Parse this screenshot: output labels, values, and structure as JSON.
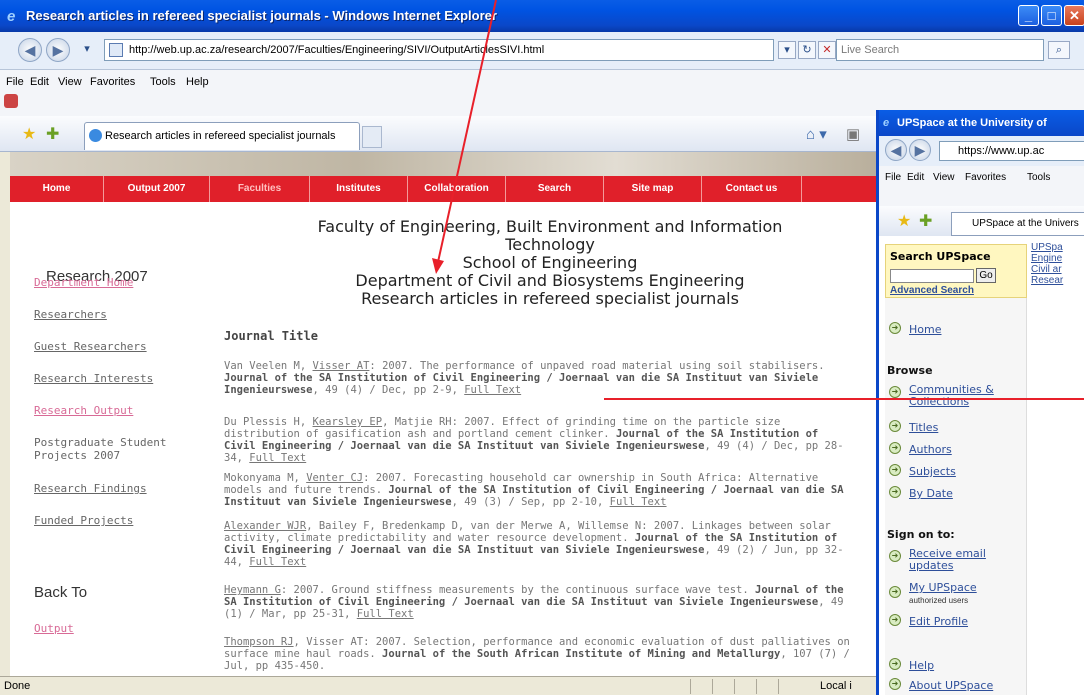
{
  "main_window": {
    "title": "Research articles in refereed specialist journals - Windows Internet Explorer",
    "address": "http://web.up.ac.za/research/2007/Faculties/Engineering/SIVI/OutputArticlesSIVI.html",
    "search_placeholder": "Live Search",
    "menu": [
      "File",
      "Edit",
      "View",
      "Favorites",
      "Tools",
      "Help"
    ],
    "tab_label": "Research articles in refereed specialist journals",
    "status": "Done",
    "zone": "Local i"
  },
  "site_nav": [
    "Home",
    "Output 2007",
    "Faculties",
    "Institutes",
    "Collaboration",
    "Search",
    "Site map",
    "Contact us"
  ],
  "sidebar": {
    "heading": "Research 2007",
    "links": {
      "department_home": "Department Home",
      "researchers": "Researchers",
      "guest_researchers": "Guest Researchers",
      "research_interests": "Research Interests",
      "research_output": "Research Output",
      "postgraduate_1": "Postgraduate Student",
      "postgraduate_2": "Projects 2007",
      "research_findings": "Research Findings",
      "funded_projects": "Funded Projects"
    },
    "back_to": "Back To",
    "output": "Output"
  },
  "heading": {
    "line1": "Faculty of Engineering, Built Environment and Information",
    "line2": "Technology",
    "line3": "School of Engineering",
    "line4": "Department of Civil and Biosystems Engineering",
    "line5": "Research articles in refereed specialist journals"
  },
  "journal_title": "Journal Title",
  "articles": [
    {
      "pre": "Van Veelen M, ",
      "link_author": "Visser AT",
      "text": ": 2007. The performance of unpaved road material using soil stabilisers. ",
      "journal": "Journal of the SA Institution of Civil Engineering / Joernaal van die SA Instituut van Siviele Ingenieurswese",
      "post": ", 49 (4) / Dec, pp 2-9, ",
      "full": "Full Text"
    },
    {
      "pre": "Du Plessis H, ",
      "link_author": "Kearsley EP",
      "text": ", Matjie RH: 2007. Effect of grinding time on the particle size distribution of gasification ash and portland cement clinker. ",
      "journal": "Journal of the SA Institution of Civil Engineering / Joernaal van die SA Instituut van Siviele Ingenieurswese",
      "post": ", 49 (4) / Dec, pp 28-34, ",
      "full": "Full Text"
    },
    {
      "pre": "Mokonyama M, ",
      "link_author": "Venter CJ",
      "text": ": 2007. Forecasting household car ownership in South Africa: Alternative models and future trends. ",
      "journal": "Journal of the SA Institution of Civil Engineering / Joernaal van die SA Instituut van Siviele Ingenieurswese",
      "post": ", 49 (3) / Sep, pp 2-10, ",
      "full": "Full Text"
    },
    {
      "pre": "",
      "link_author": "Alexander WJR",
      "text": ", Bailey F, Bredenkamp D, van der Merwe A, Willemse N: 2007. Linkages between solar activity, climate predictability and water resource development. ",
      "journal": "Journal of the SA Institution of Civil Engineering / Joernaal van die SA Instituut van Siviele Ingenieurswese",
      "post": ", 49 (2) / Jun, pp 32-44, ",
      "full": "Full Text"
    },
    {
      "pre": "",
      "link_author": "Heymann G",
      "text": ": 2007. Ground stiffness measurements by the continuous surface wave test. ",
      "journal": "Journal of the SA Institution of Civil Engineering / Joernaal van die SA Instituut van Siviele Ingenieurswese",
      "post": ", 49 (1) / Mar, pp 25-31, ",
      "full": "Full Text"
    },
    {
      "pre": "",
      "link_author": "Thompson RJ",
      "text": ", Visser AT: 2007. Selection, performance and economic evaluation of dust palliatives on surface mine haul roads. ",
      "journal": "Journal of the South African Institute of Mining and Metallurgy",
      "post": ", 107 (7) / Jul, pp 435-450.",
      "full": ""
    }
  ],
  "second_window": {
    "title": "UPSpace at the University of",
    "address": "https://www.up.ac",
    "menu": [
      "File",
      "Edit",
      "View",
      "Favorites",
      "Tools"
    ],
    "tab_label": "UPSpace at the Univers",
    "search_heading": "Search UPSpace",
    "go": "Go",
    "advanced": "Advanced Search",
    "home": "Home",
    "browse": "Browse",
    "browse_items": [
      "Communities & Collections",
      "Titles",
      "Authors",
      "Subjects",
      "By Date"
    ],
    "sign_on": "Sign on to:",
    "sign_items": [
      "Receive email updates",
      "My UPSpace",
      "Edit Profile"
    ],
    "authorized": "authorized users",
    "help": "Help",
    "about": "About UPSpace",
    "right_links": [
      "UPSpa",
      "Engine",
      "Civil ar",
      "Resear"
    ]
  },
  "colors": {
    "annotation": "#e8202a",
    "nav_red": "#e0202a",
    "titlebar": "#0a5de6"
  }
}
